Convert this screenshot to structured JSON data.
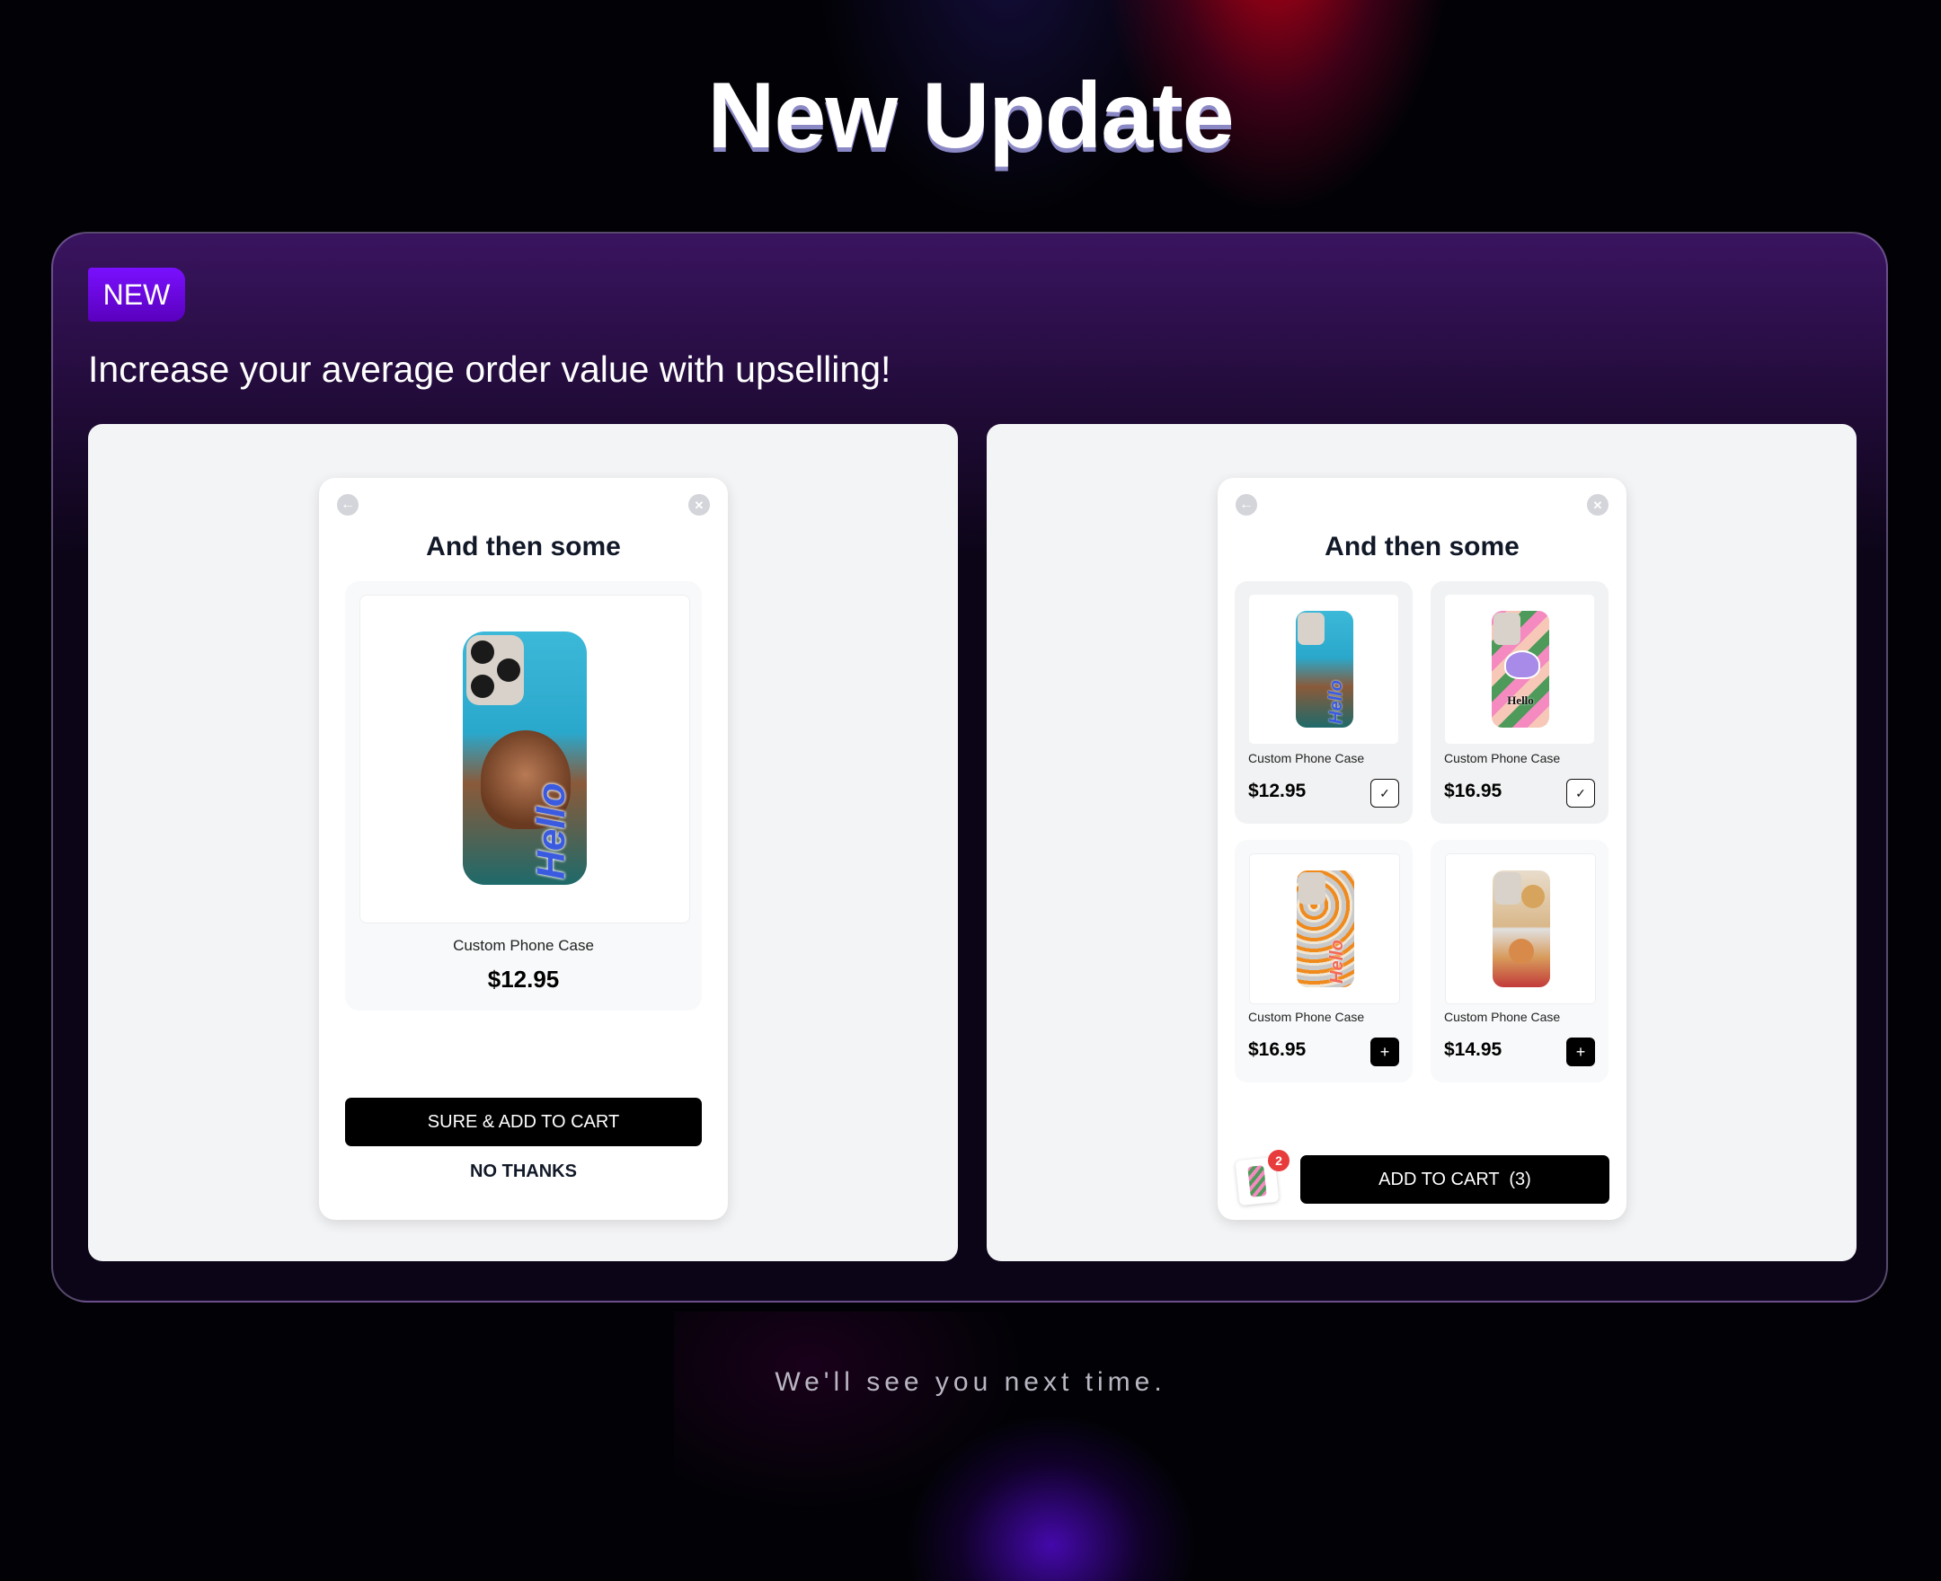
{
  "header": {
    "title": "New Update"
  },
  "announcement": {
    "badge": "NEW",
    "headline": "Increase your average order value with upselling!"
  },
  "single_offer_modal": {
    "title": "And then some",
    "product": {
      "name": "Custom Phone Case",
      "price": "$12.95",
      "image_text": "Hello"
    },
    "primary_button": "SURE & ADD TO CART",
    "secondary_button": "NO THANKS",
    "icons": {
      "back": "back-arrow-icon",
      "close": "close-icon"
    }
  },
  "multi_offer_modal": {
    "title": "And then some",
    "products": [
      {
        "name": "Custom Phone Case",
        "price": "$12.95",
        "selected": true,
        "image_text": "Hello"
      },
      {
        "name": "Custom Phone Case",
        "price": "$16.95",
        "selected": true,
        "image_text": "Hello"
      },
      {
        "name": "Custom Phone Case",
        "price": "$16.95",
        "selected": false,
        "image_text": "Hello"
      },
      {
        "name": "Custom Phone Case",
        "price": "$14.95",
        "selected": false,
        "image_text": ""
      }
    ],
    "cart_badge_count": "2",
    "add_to_cart_button": "ADD TO CART  (3)",
    "icons": {
      "back": "back-arrow-icon",
      "close": "close-icon",
      "selected": "check-icon",
      "add": "plus-icon"
    }
  },
  "glyphs": {
    "back": "←",
    "close": "✕",
    "check": "✓",
    "plus": "+"
  },
  "footer": {
    "text": "We'll see you next time."
  },
  "colors": {
    "accent": "#7a10ff",
    "badge_red": "#e83b3b",
    "button": "#000000"
  }
}
